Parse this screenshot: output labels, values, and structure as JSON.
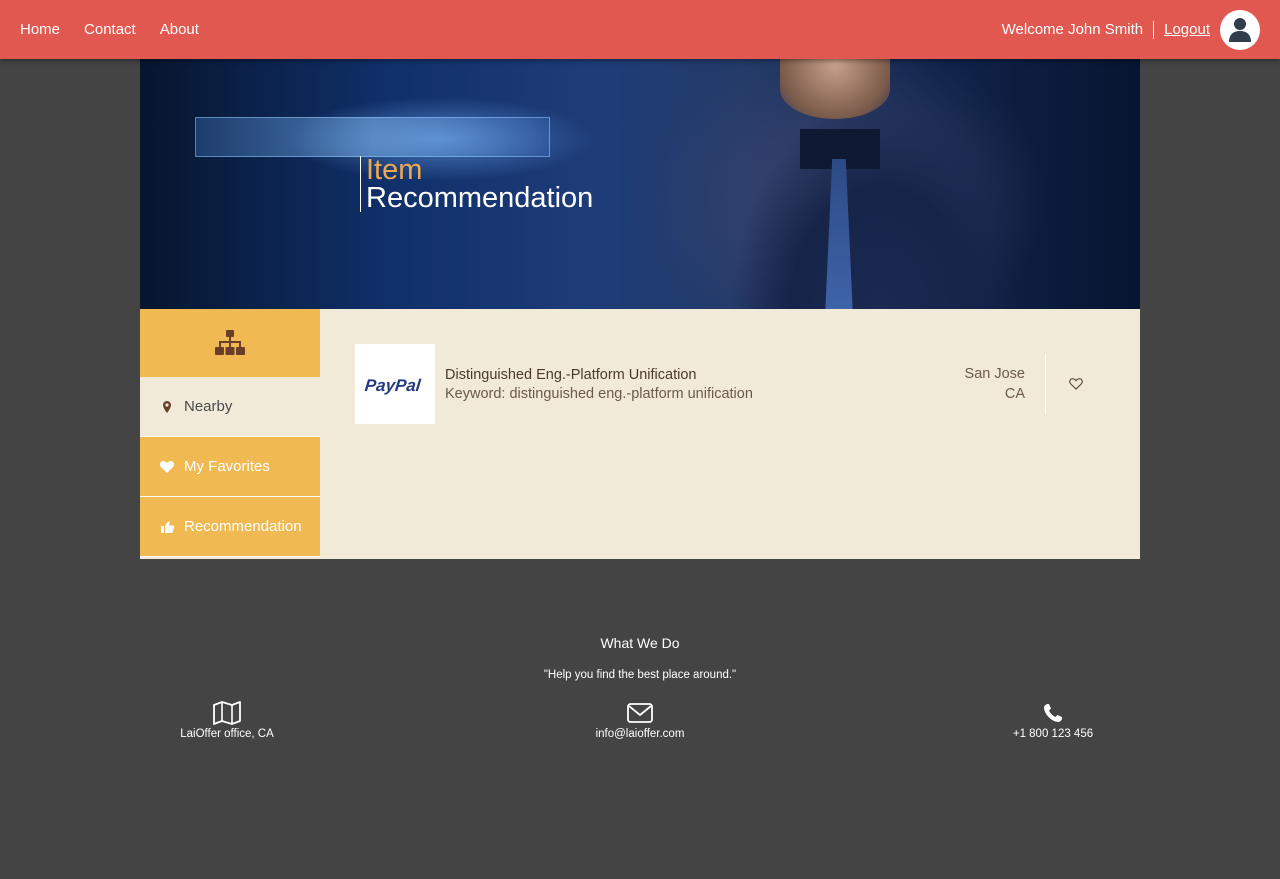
{
  "nav": {
    "links": [
      "Home",
      "Contact",
      "About"
    ],
    "welcome": "Welcome John Smith",
    "logout": "Logout",
    "bg_color": "#e0584f"
  },
  "hero": {
    "title_line1": "Item",
    "title_line2": "Recommendation",
    "accent_color": "#f0a94f"
  },
  "sidebar": {
    "top_icon": "sitemap-icon",
    "items": [
      {
        "label": "Nearby",
        "icon": "map-marker-icon",
        "active": false
      },
      {
        "label": "My Favorites",
        "icon": "heart-icon",
        "active": true
      },
      {
        "label": "Recommendation",
        "icon": "thumbs-up-icon",
        "active": true
      }
    ],
    "active_color": "#f0b952"
  },
  "items": [
    {
      "name": "Distinguished Eng.-Platform Unification",
      "keyword": "Keyword: distinguished eng.-platform unification",
      "city": "San Jose",
      "state": "CA",
      "logo_text": "PayPal",
      "favorite": false
    }
  ],
  "footer": {
    "title": "What We Do",
    "quote": "\"Help you find the best place around.\"",
    "contacts": [
      {
        "icon": "map-icon",
        "text": "LaiOffer office, CA"
      },
      {
        "icon": "envelope-icon",
        "text": "info@laioffer.com"
      },
      {
        "icon": "phone-icon",
        "text": "+1 800 123 456"
      }
    ]
  }
}
